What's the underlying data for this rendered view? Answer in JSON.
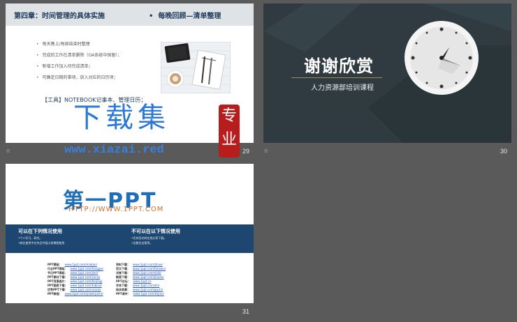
{
  "slides": [
    {
      "number": "29",
      "chapter_title": "第四章：时间管理的具体实施",
      "review_title": "每晚回顾—清单整理",
      "bullets": [
        "每天晚上/每周结束时整理",
        "完成的工作在清单删除（OA系统中保留）；",
        "新增工作加入待完成清单；",
        "可确定日期的事项，放入对应的日历项；"
      ],
      "tools_line": "【工具】NOTEBOOK记事本、管理日历；"
    },
    {
      "number": "30",
      "title": "谢谢欣赏",
      "subtitle": "人力资源部培训课程"
    },
    {
      "number": "31",
      "logo": "第一PPT",
      "url": "HTTP://WWW.1PPT.COM",
      "can_use": "可以在下列情况使用",
      "cannot_use": "不可以在以下情况使用",
      "can_use_items": [
        "•个人学习、研究。",
        "•商业使用中在作品中展示效果图使用"
      ],
      "cannot_use_items": [
        "•任何形式的在线分享下载。",
        "•出售及出租等。"
      ],
      "links_left": [
        [
          "PPT模板：",
          "www.1ppt.com/moban/"
        ],
        [
          "行业PPT模板：",
          "www.1ppt.com/hangye/"
        ],
        [
          "节日PPT模板：",
          "www.1ppt.com/jieri/"
        ],
        [
          "PPT素材下载：",
          "www.1ppt.com/sucai/"
        ],
        [
          "PPT背景图片：",
          "www.1ppt.com/beijing/"
        ],
        [
          "PPT图表下载：",
          "www.1ppt.com/tubiao/"
        ],
        [
          "优秀PPT下载：",
          "www.1ppt.com/xiazai/"
        ],
        [
          "PPT教程：",
          "www.1ppt.com/powerpoint/"
        ]
      ],
      "links_right": [
        [
          "资料下载：",
          "www.1ppt.com/ziliao/"
        ],
        [
          "范文下载：",
          "www.1ppt.com/fanwen/"
        ],
        [
          "试卷下载：",
          "www.1ppt.com/shiti/"
        ],
        [
          "教案下载：",
          "www.1ppt.com/jiaoan/"
        ],
        [
          "PPT论坛：",
          "www.1ppt.cn"
        ],
        [
          "字体下载：",
          "www.1ppt.com/ziti/"
        ],
        [
          "绘本故事：",
          "www.1ppt.com/gushi/"
        ],
        [
          "PPT课件：",
          "www.1ppt.com/kejian/"
        ]
      ]
    }
  ],
  "watermark": {
    "brand": "下载集",
    "domain": "www.xiazai.red",
    "seal": "专业"
  },
  "slide_markers": [
    "☆",
    "☆"
  ],
  "colors": {
    "background": "#5a5a5a",
    "dark_slide": "#2f3b40",
    "navy_band": "#1d4670",
    "watermark_blue": "#2b78d8",
    "seal_red": "#b71d1d"
  }
}
